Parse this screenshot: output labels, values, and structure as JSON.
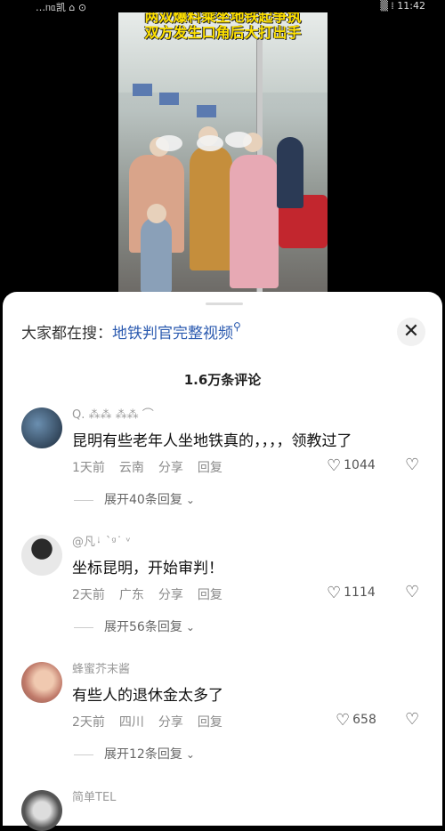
{
  "status_bar": {
    "left": "…ᥒᥲ凯 ⌂ ⊙",
    "right": "▒ ⁞ 11:42"
  },
  "video": {
    "caption_line1": "两双爆料乘坐地铁起争执",
    "caption_line2": "双方发生口角后大打出手"
  },
  "search": {
    "hint": "大家都在搜：",
    "keyword": "地铁判官完整视频",
    "close_label": "✕"
  },
  "comment_count": "1.6万条评论",
  "icons": {
    "search": "search-icon",
    "close": "close-icon",
    "like": "heart-icon",
    "dislike": "broken-heart-icon",
    "expand": "chevron-down-icon"
  },
  "comments": [
    {
      "username": "Q. ⁂⁂ ⁂⁂ ⌒",
      "text": "昆明有些老年人坐地铁真的，，，，领教过了",
      "time": "1天前",
      "location": "云南",
      "share": "分享",
      "reply": "回复",
      "likes": "1044",
      "expand": "展开40条回复"
    },
    {
      "username": "@凡ᛍ ˋᵍ˙ ᵛ",
      "text": "坐标昆明，开始审判！",
      "time": "2天前",
      "location": "广东",
      "share": "分享",
      "reply": "回复",
      "likes": "1114",
      "expand": "展开56条回复"
    },
    {
      "username": "蜂蜜芥末酱",
      "text": "有些人的退休金太多了",
      "time": "2天前",
      "location": "四川",
      "share": "分享",
      "reply": "回复",
      "likes": "658",
      "expand": "展开12条回复"
    },
    {
      "username": "简单TEL",
      "text": "",
      "time": "",
      "location": "",
      "share": "",
      "reply": "",
      "likes": "",
      "expand": ""
    }
  ]
}
